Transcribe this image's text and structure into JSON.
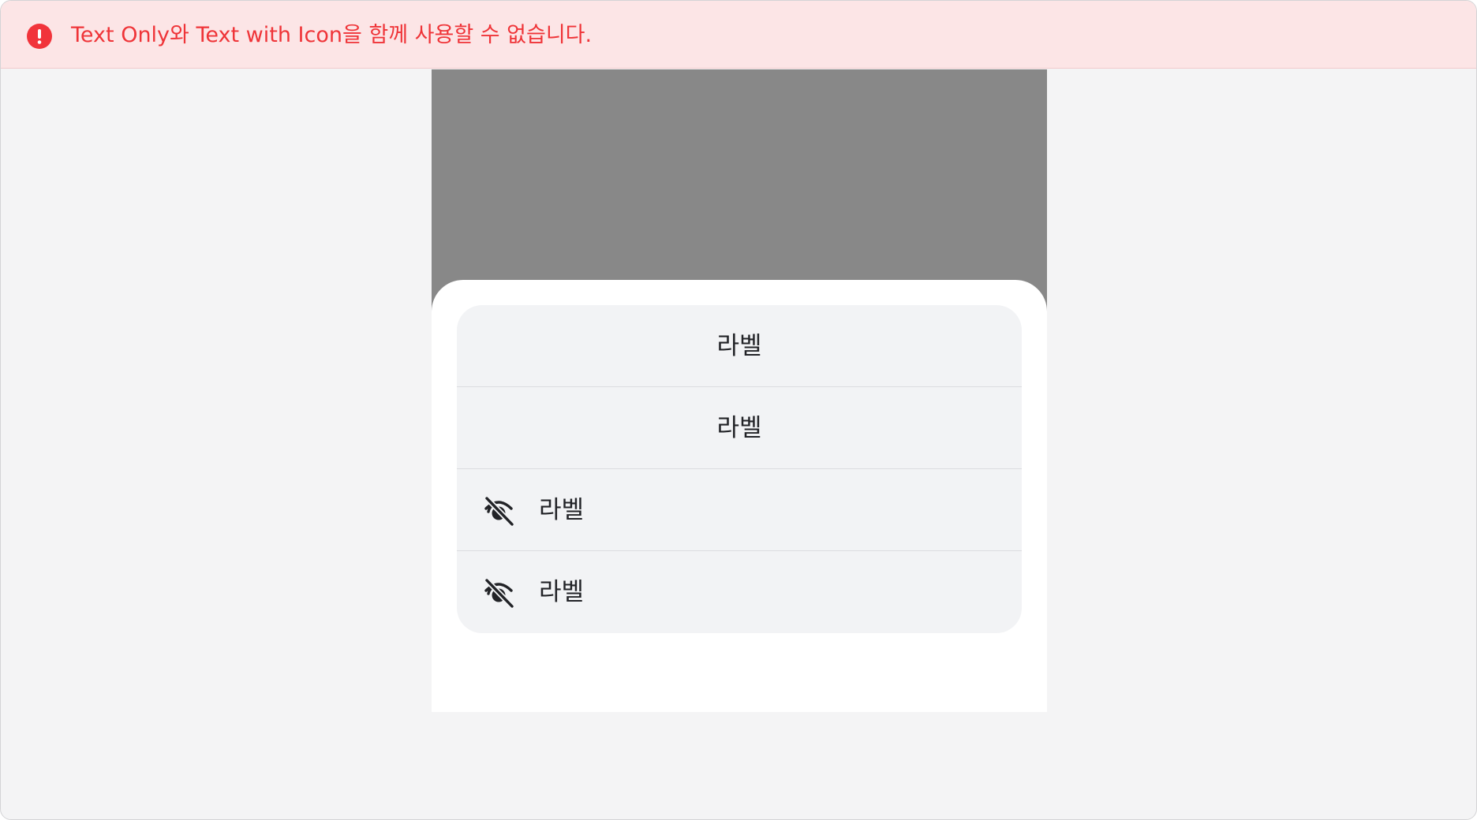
{
  "error_banner": {
    "message": "Text Only와 Text with Icon을 함께 사용할 수 없습니다.",
    "icon": "exclamation-circle-icon",
    "color": "#ef3438"
  },
  "action_sheet": {
    "items": [
      {
        "label": "라벨",
        "type": "text-only"
      },
      {
        "label": "라벨",
        "type": "text-only"
      },
      {
        "label": "라벨",
        "type": "text-with-icon",
        "icon": "eye-off-icon"
      },
      {
        "label": "라벨",
        "type": "text-with-icon",
        "icon": "eye-off-icon"
      }
    ]
  },
  "colors": {
    "dim_overlay": "#888888",
    "sheet_background": "#ffffff",
    "list_background": "#f2f3f5",
    "error_background": "#fce5e6"
  }
}
